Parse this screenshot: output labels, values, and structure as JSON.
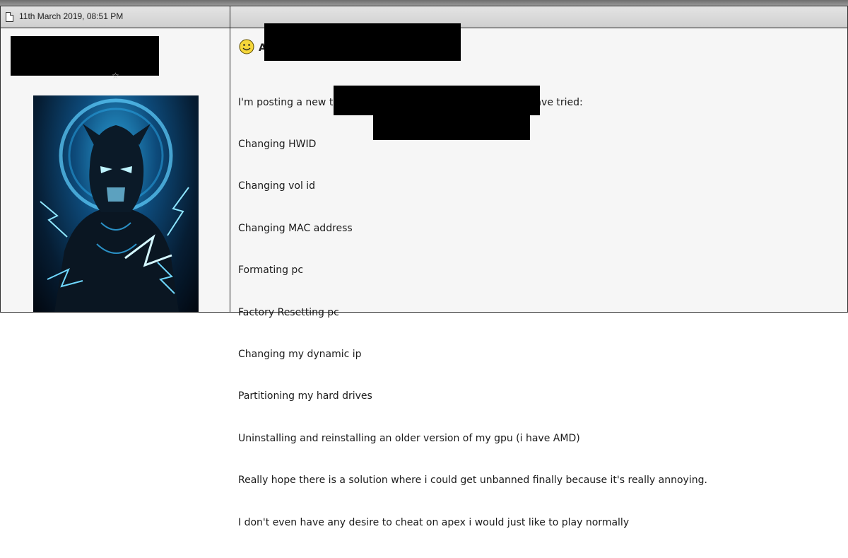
{
  "post": {
    "date": "11th March 2019, 08:51 PM",
    "title_prefix": "A",
    "lines": [
      "I'm posting a new thread of this topic because now since i have tried:",
      "Changing HWID",
      "Changing vol id",
      "Changing MAC address",
      "Formating pc",
      "Factory Resetting pc",
      "Changing my dynamic ip",
      "Partitioning my hard drives",
      "Uninstalling and reinstalling an older version of my gpu (i have AMD)",
      "Really hope there is a solution where i could get unbanned finally because it's really annoying.",
      "I don't even have any desire to cheat on apex i would just like to play normally"
    ]
  },
  "icons": {
    "post_icon": "document-icon",
    "title_icon": "smiley-icon",
    "rank_icon": "star-icon"
  },
  "colors": {
    "header_bg": "#d9d9d9",
    "post_bg": "#f6f6f6",
    "border": "#222222",
    "redaction": "#000000"
  }
}
